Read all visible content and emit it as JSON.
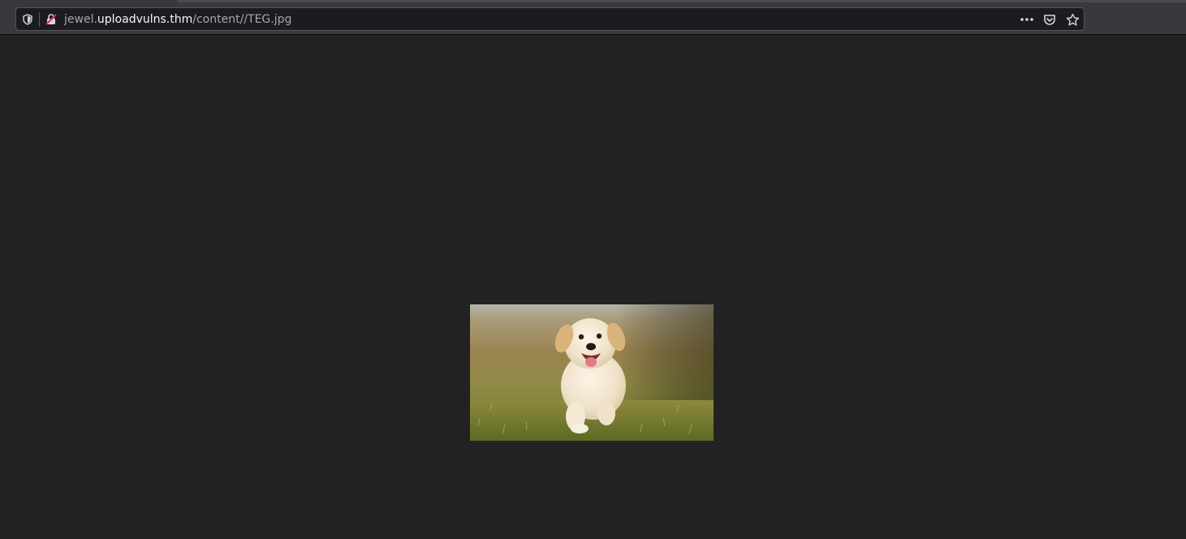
{
  "browser": {
    "url": {
      "prefix": "jewel.",
      "host": "uploadvulns.thm",
      "path": "/content//TEG.jpg"
    },
    "icons": {
      "tracking_protection": "shield-icon",
      "connection": "insecure-lock-icon",
      "page_actions": "meatball-menu-icon",
      "pocket": "pocket-icon",
      "bookmark": "star-icon"
    }
  },
  "viewer": {
    "image_subject": "puppy-running-on-grass",
    "colors": {
      "background": "#222222",
      "toolbar": "#38383d",
      "urlbar": "#1c1b22"
    }
  }
}
